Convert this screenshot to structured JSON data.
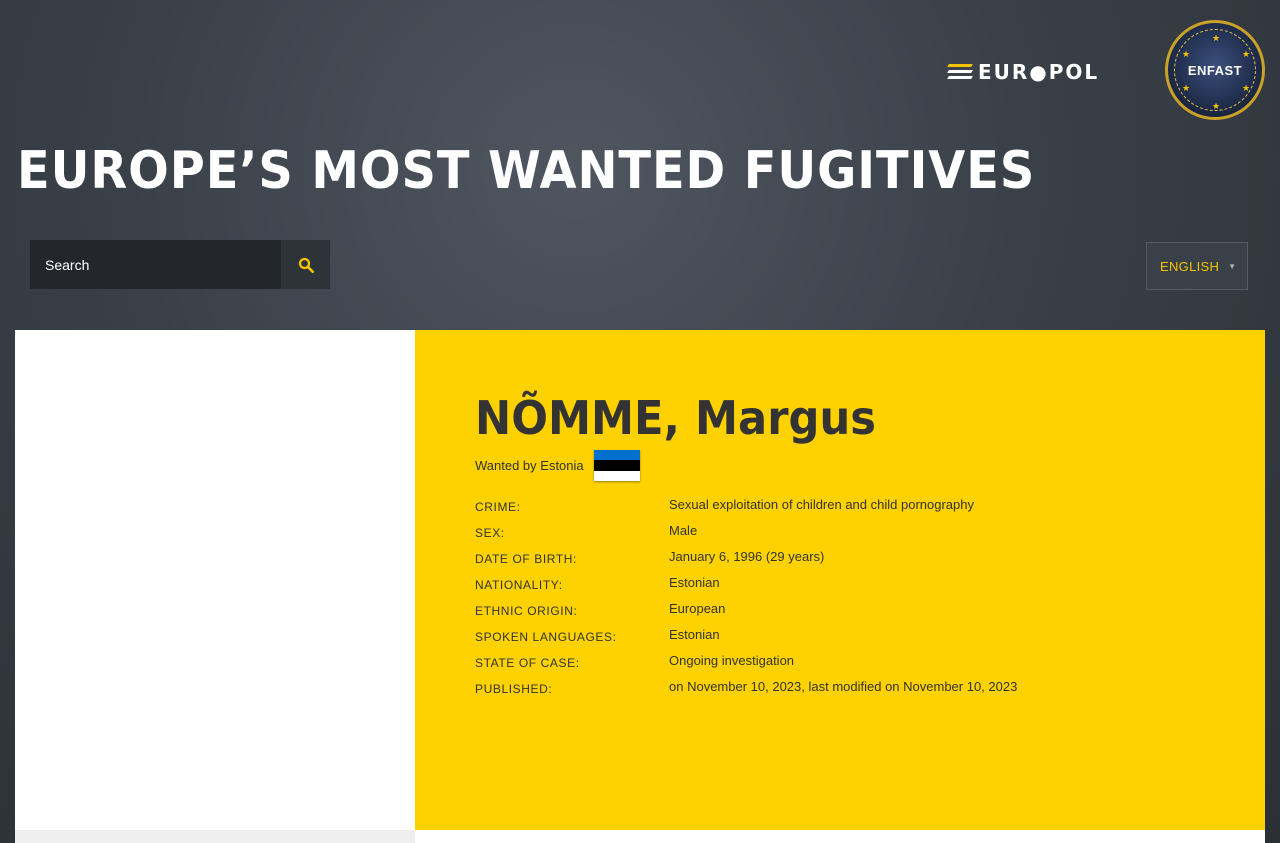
{
  "header": {
    "europol_logo_text": "EUR●POL",
    "enfast_badge_text": "ENFAST",
    "title": "EUROPE’S MOST WANTED FUGITIVES"
  },
  "search": {
    "placeholder": "Search",
    "icon": "search-icon"
  },
  "language": {
    "selected": "ENGLISH",
    "icon": "chevron-down-icon"
  },
  "colors": {
    "accent_yellow": "#fed201",
    "flag_estonia": [
      "#0072ce",
      "#000000",
      "#ffffff"
    ]
  },
  "fugitive": {
    "name": "NÕMME, Margus",
    "wanted_by": "Wanted by Estonia",
    "details": [
      {
        "label": "CRIME:",
        "value": "Sexual exploitation of children and child pornography"
      },
      {
        "label": "SEX:",
        "value": "Male"
      },
      {
        "label": "DATE OF BIRTH:",
        "value": "January 6, 1996 (29 years)"
      },
      {
        "label": "NATIONALITY:",
        "value": "Estonian"
      },
      {
        "label": "ETHNIC ORIGIN:",
        "value": "European"
      },
      {
        "label": "SPOKEN LANGUAGES:",
        "value": "Estonian"
      },
      {
        "label": "STATE OF CASE:",
        "value": "Ongoing investigation"
      },
      {
        "label": "PUBLISHED:",
        "value": "on November 10, 2023, last modified on November 10, 2023"
      }
    ]
  }
}
